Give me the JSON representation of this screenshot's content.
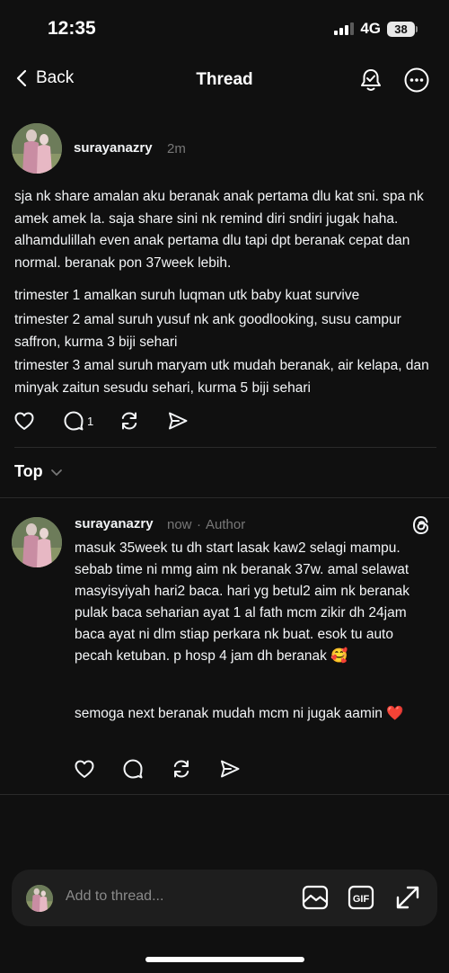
{
  "status_bar": {
    "time": "12:35",
    "network": "4G",
    "battery": "38"
  },
  "nav": {
    "back_label": "Back",
    "title": "Thread"
  },
  "post": {
    "username": "surayanazry",
    "time": "2m",
    "paragraphs": [
      "sja nk share amalan aku beranak anak pertama dlu kat sni. spa nk amek amek la. saja share sini nk remind diri sndiri jugak haha. alhamdulillah even anak pertama dlu tapi dpt beranak cepat dan normal. beranak pon 37week lebih.",
      "trimester 1 amalkan suruh luqman utk baby kuat survive",
      "trimester 2 amal suruh yusuf nk ank goodlooking, susu campur saffron, kurma 3 biji sehari",
      "trimester 3 amal suruh maryam utk mudah beranak, air kelapa, dan minyak zaitun sesudu sehari, kurma 5 biji sehari"
    ],
    "reply_count": "1"
  },
  "sort": {
    "label": "Top"
  },
  "reply": {
    "username": "surayanazry",
    "time": "now",
    "separator": "·",
    "badge": "Author",
    "paragraphs": [
      "masuk 35week tu dh start lasak kaw2 selagi mampu. sebab time ni mmg aim nk beranak 37w. amal selawat masyisyiyah hari2 baca. hari yg betul2 aim nk beranak pulak baca seharian ayat 1 al fath mcm zikir dh 24jam baca ayat ni dlm stiap perkara nk buat. esok tu auto pecah ketuban. p hosp 4 jam dh beranak 🥰",
      "semoga next beranak mudah mcm ni jugak aamin ❤️"
    ]
  },
  "composer": {
    "placeholder": "Add to thread...",
    "gif_label": "GIF"
  },
  "colors": {
    "background": "#101010",
    "text": "#f3f5f7",
    "muted": "#777777",
    "divider": "#2a2a2a",
    "composer_bg": "#1e1e1e"
  },
  "icons": [
    "chevron-left-icon",
    "bell-check-icon",
    "more-icon",
    "heart-icon",
    "comment-icon",
    "repost-icon",
    "share-icon",
    "chevron-down-icon",
    "threads-logo-icon",
    "image-icon",
    "gif-icon",
    "expand-icon"
  ]
}
